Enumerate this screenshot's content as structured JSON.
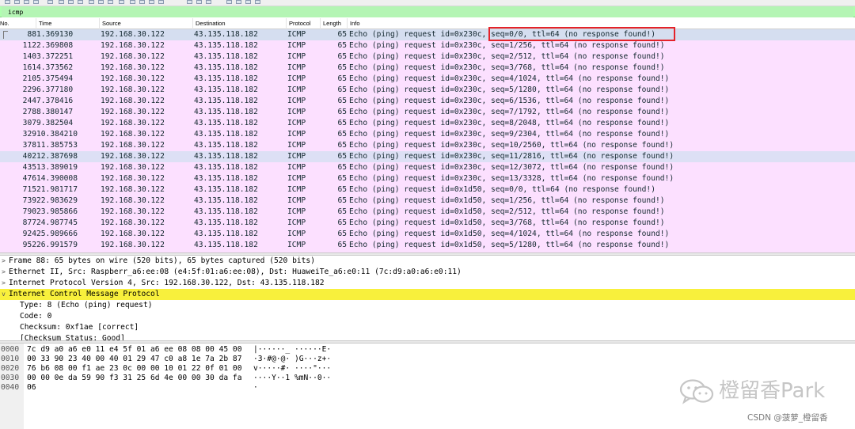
{
  "filter": {
    "value": "icmp"
  },
  "columns": [
    "No.",
    "Time",
    "Source",
    "Destination",
    "Protocol",
    "Length",
    "Info"
  ],
  "packets": [
    {
      "no": "88",
      "time": "1.369130",
      "src": "192.168.30.122",
      "dst": "43.135.118.182",
      "proto": "ICMP",
      "len": "65",
      "info": "Echo (ping) request  id=0x230c, seq=0/0, ttl=64 (no response found!)"
    },
    {
      "no": "112",
      "time": "2.369808",
      "src": "192.168.30.122",
      "dst": "43.135.118.182",
      "proto": "ICMP",
      "len": "65",
      "info": "Echo (ping) request  id=0x230c, seq=1/256, ttl=64 (no response found!)"
    },
    {
      "no": "140",
      "time": "3.372251",
      "src": "192.168.30.122",
      "dst": "43.135.118.182",
      "proto": "ICMP",
      "len": "65",
      "info": "Echo (ping) request  id=0x230c, seq=2/512, ttl=64 (no response found!)"
    },
    {
      "no": "161",
      "time": "4.373562",
      "src": "192.168.30.122",
      "dst": "43.135.118.182",
      "proto": "ICMP",
      "len": "65",
      "info": "Echo (ping) request  id=0x230c, seq=3/768, ttl=64 (no response found!)"
    },
    {
      "no": "210",
      "time": "5.375494",
      "src": "192.168.30.122",
      "dst": "43.135.118.182",
      "proto": "ICMP",
      "len": "65",
      "info": "Echo (ping) request  id=0x230c, seq=4/1024, ttl=64 (no response found!)"
    },
    {
      "no": "229",
      "time": "6.377180",
      "src": "192.168.30.122",
      "dst": "43.135.118.182",
      "proto": "ICMP",
      "len": "65",
      "info": "Echo (ping) request  id=0x230c, seq=5/1280, ttl=64 (no response found!)"
    },
    {
      "no": "244",
      "time": "7.378416",
      "src": "192.168.30.122",
      "dst": "43.135.118.182",
      "proto": "ICMP",
      "len": "65",
      "info": "Echo (ping) request  id=0x230c, seq=6/1536, ttl=64 (no response found!)"
    },
    {
      "no": "278",
      "time": "8.380147",
      "src": "192.168.30.122",
      "dst": "43.135.118.182",
      "proto": "ICMP",
      "len": "65",
      "info": "Echo (ping) request  id=0x230c, seq=7/1792, ttl=64 (no response found!)"
    },
    {
      "no": "307",
      "time": "9.382504",
      "src": "192.168.30.122",
      "dst": "43.135.118.182",
      "proto": "ICMP",
      "len": "65",
      "info": "Echo (ping) request  id=0x230c, seq=8/2048, ttl=64 (no response found!)"
    },
    {
      "no": "329",
      "time": "10.384210",
      "src": "192.168.30.122",
      "dst": "43.135.118.182",
      "proto": "ICMP",
      "len": "65",
      "info": "Echo (ping) request  id=0x230c, seq=9/2304, ttl=64 (no response found!)"
    },
    {
      "no": "378",
      "time": "11.385753",
      "src": "192.168.30.122",
      "dst": "43.135.118.182",
      "proto": "ICMP",
      "len": "65",
      "info": "Echo (ping) request  id=0x230c, seq=10/2560, ttl=64 (no response found!)"
    },
    {
      "no": "402",
      "time": "12.387698",
      "src": "192.168.30.122",
      "dst": "43.135.118.182",
      "proto": "ICMP",
      "len": "65",
      "info": "Echo (ping) request  id=0x230c, seq=11/2816, ttl=64 (no response found!)"
    },
    {
      "no": "435",
      "time": "13.389019",
      "src": "192.168.30.122",
      "dst": "43.135.118.182",
      "proto": "ICMP",
      "len": "65",
      "info": "Echo (ping) request  id=0x230c, seq=12/3072, ttl=64 (no response found!)"
    },
    {
      "no": "476",
      "time": "14.390008",
      "src": "192.168.30.122",
      "dst": "43.135.118.182",
      "proto": "ICMP",
      "len": "65",
      "info": "Echo (ping) request  id=0x230c, seq=13/3328, ttl=64 (no response found!)"
    },
    {
      "no": "715",
      "time": "21.981717",
      "src": "192.168.30.122",
      "dst": "43.135.118.182",
      "proto": "ICMP",
      "len": "65",
      "info": "Echo (ping) request  id=0x1d50, seq=0/0, ttl=64 (no response found!)"
    },
    {
      "no": "739",
      "time": "22.983629",
      "src": "192.168.30.122",
      "dst": "43.135.118.182",
      "proto": "ICMP",
      "len": "65",
      "info": "Echo (ping) request  id=0x1d50, seq=1/256, ttl=64 (no response found!)"
    },
    {
      "no": "790",
      "time": "23.985866",
      "src": "192.168.30.122",
      "dst": "43.135.118.182",
      "proto": "ICMP",
      "len": "65",
      "info": "Echo (ping) request  id=0x1d50, seq=2/512, ttl=64 (no response found!)"
    },
    {
      "no": "877",
      "time": "24.987745",
      "src": "192.168.30.122",
      "dst": "43.135.118.182",
      "proto": "ICMP",
      "len": "65",
      "info": "Echo (ping) request  id=0x1d50, seq=3/768, ttl=64 (no response found!)"
    },
    {
      "no": "924",
      "time": "25.989666",
      "src": "192.168.30.122",
      "dst": "43.135.118.182",
      "proto": "ICMP",
      "len": "65",
      "info": "Echo (ping) request  id=0x1d50, seq=4/1024, ttl=64 (no response found!)"
    },
    {
      "no": "952",
      "time": "26.991579",
      "src": "192.168.30.122",
      "dst": "43.135.118.182",
      "proto": "ICMP",
      "len": "65",
      "info": "Echo (ping) request  id=0x1d50, seq=5/1280, ttl=64 (no response found!)"
    }
  ],
  "details": [
    {
      "text": "Frame 88: 65 bytes on wire (520 bits), 65 bytes captured (520 bits)",
      "arrow": ">"
    },
    {
      "text": "Ethernet II, Src: Raspberr_a6:ee:08 (e4:5f:01:a6:ee:08), Dst: HuaweiTe_a6:e0:11 (7c:d9:a0:a6:e0:11)",
      "arrow": ">"
    },
    {
      "text": "Internet Protocol Version 4, Src: 192.168.30.122, Dst: 43.135.118.182",
      "arrow": ">"
    },
    {
      "text": "Internet Control Message Protocol",
      "arrow": "v"
    },
    {
      "text": "Type: 8 (Echo (ping) request)",
      "arrow": ""
    },
    {
      "text": "Code: 0",
      "arrow": ""
    },
    {
      "text": "Checksum: 0xf1ae [correct]",
      "arrow": ""
    },
    {
      "text": "[Checksum Status: Good]",
      "arrow": ""
    }
  ],
  "bytes": [
    {
      "offset": "0000",
      "hex": "7c d9 a0 a6 e0 11 e4 5f  01 a6 ee 08 08 00 45 00",
      "ascii": "|······_ ······E·"
    },
    {
      "offset": "0010",
      "hex": "00 33 90 23 40 00 40 01  29 47 c0 a8 1e 7a 2b 87",
      "ascii": "·3·#@·@· )G···z+·"
    },
    {
      "offset": "0020",
      "hex": "76 b6 08 00 f1 ae 23 0c  00 00 10 01 22 0f 01 00",
      "ascii": "v·····#· ····\"···"
    },
    {
      "offset": "0030",
      "hex": "00 00 0e da 59 90 f3 31  25 6d 4e 00 00 30 da fa",
      "ascii": "····Y··1 %mN··0··"
    },
    {
      "offset": "0040",
      "hex": "06",
      "ascii": "·"
    }
  ],
  "watermark": {
    "text": "橙留香Park",
    "csdn": "CSDN @菠萝_橙留香"
  },
  "colors": {
    "row_bg": "#fce0ff",
    "selected_row": "#d5def0",
    "detail_highlight": "#f8f03c",
    "filter_bg": "#afffaf",
    "annotation_box": "#e5222a"
  }
}
